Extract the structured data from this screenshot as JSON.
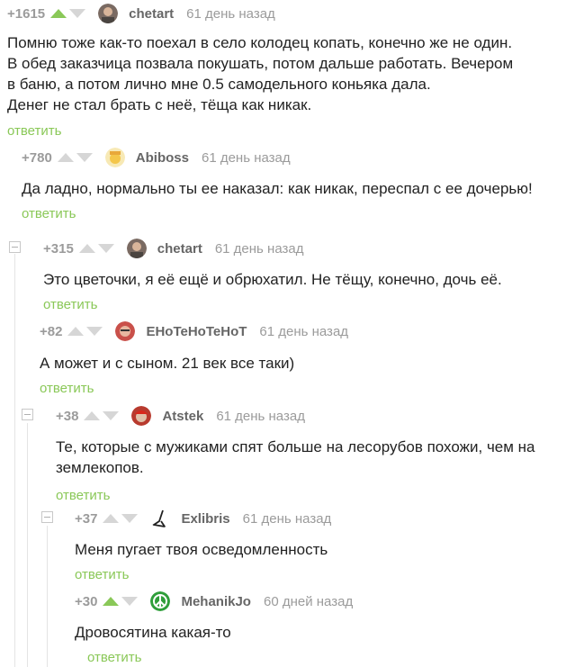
{
  "reply_label": "ответить",
  "colors": {
    "accent": "#8ac858",
    "muted": "#9b9b9b",
    "author": "#666666"
  },
  "comments": [
    {
      "rating": "+1615",
      "author": "chetart",
      "time": "61 день назад",
      "upvoted": true,
      "avatar_icon": "user-photo-avatar",
      "text": "Помню тоже как-то поехал в село колодец копать, конечно же не один.\nВ обед заказчица позвала покушать, потом дальше работать. Вечером\n в баню, а потом лично мне 0.5 самодельного коньяка дала.\nДенег не стал брать с неё, тёща как никак."
    },
    {
      "rating": "+780",
      "author": "Abiboss",
      "time": "61 день назад",
      "upvoted": false,
      "avatar_icon": "cartoon-avatar",
      "text": "Да ладно, нормально ты ее наказал: как никак, переспал с ее дочерью!"
    },
    {
      "rating": "+315",
      "author": "chetart",
      "time": "61 день назад",
      "upvoted": false,
      "avatar_icon": "user-photo-avatar",
      "text": "Это цветочки, я её ещё и обрюхатил. Не тёщу, конечно, дочь её."
    },
    {
      "rating": "+82",
      "author": "EHoTeHoTeHoT",
      "time": "61 день назад",
      "upvoted": false,
      "avatar_icon": "face-avatar",
      "text": "А может и с сыном. 21 век все таки)"
    },
    {
      "rating": "+38",
      "author": "Atstek",
      "time": "61 день назад",
      "upvoted": false,
      "avatar_icon": "red-helmet-avatar",
      "text": "Те, которые с мужиками спят больше на лесорубов похожи, чем на\nземлекопов."
    },
    {
      "rating": "+37",
      "author": "Exlibris",
      "time": "61 день назад",
      "upvoted": false,
      "avatar_icon": "sketch-figure-avatar",
      "text": "Меня пугает твоя осведомленность"
    },
    {
      "rating": "+30",
      "author": "MehanikJo",
      "time": "60 дней назад",
      "upvoted": true,
      "avatar_icon": "peace-sign-avatar",
      "text": "Дровосятина какая-то"
    }
  ]
}
